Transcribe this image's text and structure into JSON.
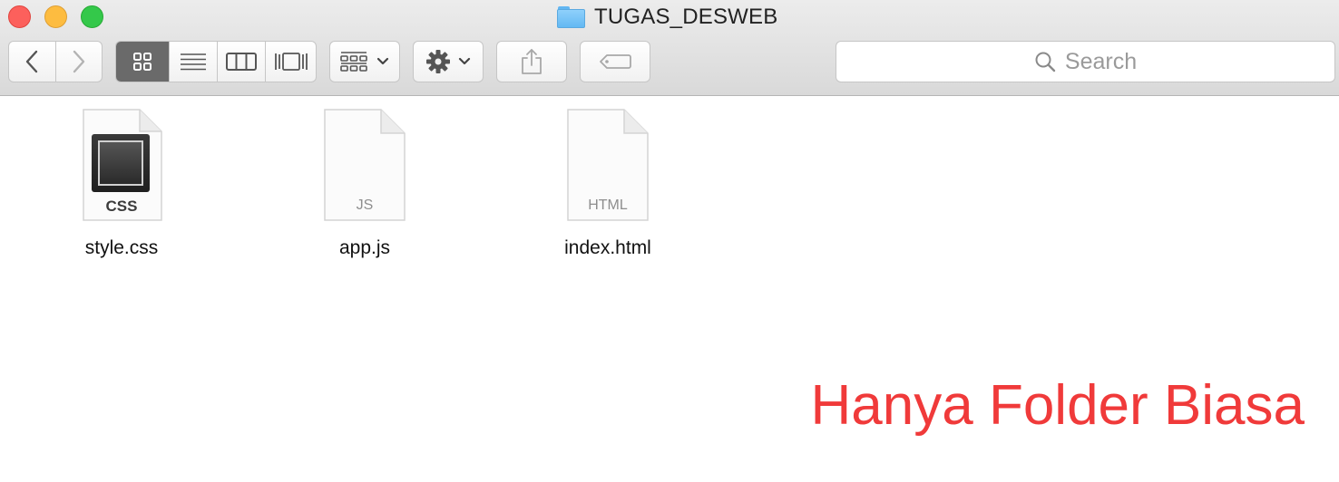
{
  "window": {
    "title": "TUGAS_DESWEB",
    "folder_icon": "folder-icon",
    "accent_color": "#62b6f2"
  },
  "toolbar": {
    "back_icon": "chevron-left-icon",
    "forward_icon": "chevron-right-icon",
    "view_modes": [
      "icon-view",
      "list-view",
      "column-view",
      "cover-flow-view"
    ],
    "active_view": "icon-view",
    "group_icon": "group-by-icon",
    "action_icon": "gear-icon",
    "share_icon": "share-icon",
    "tag_icon": "tag-icon"
  },
  "search": {
    "placeholder": "Search",
    "icon": "search-icon"
  },
  "files": [
    {
      "name": "style.css",
      "type_label": "CSS",
      "icon": "css-file-icon"
    },
    {
      "name": "app.js",
      "type_label": "JS",
      "icon": "js-file-icon"
    },
    {
      "name": "index.html",
      "type_label": "HTML",
      "icon": "html-file-icon"
    }
  ],
  "caption": {
    "text": "Hanya Folder Biasa",
    "color": "#f03a3a"
  }
}
